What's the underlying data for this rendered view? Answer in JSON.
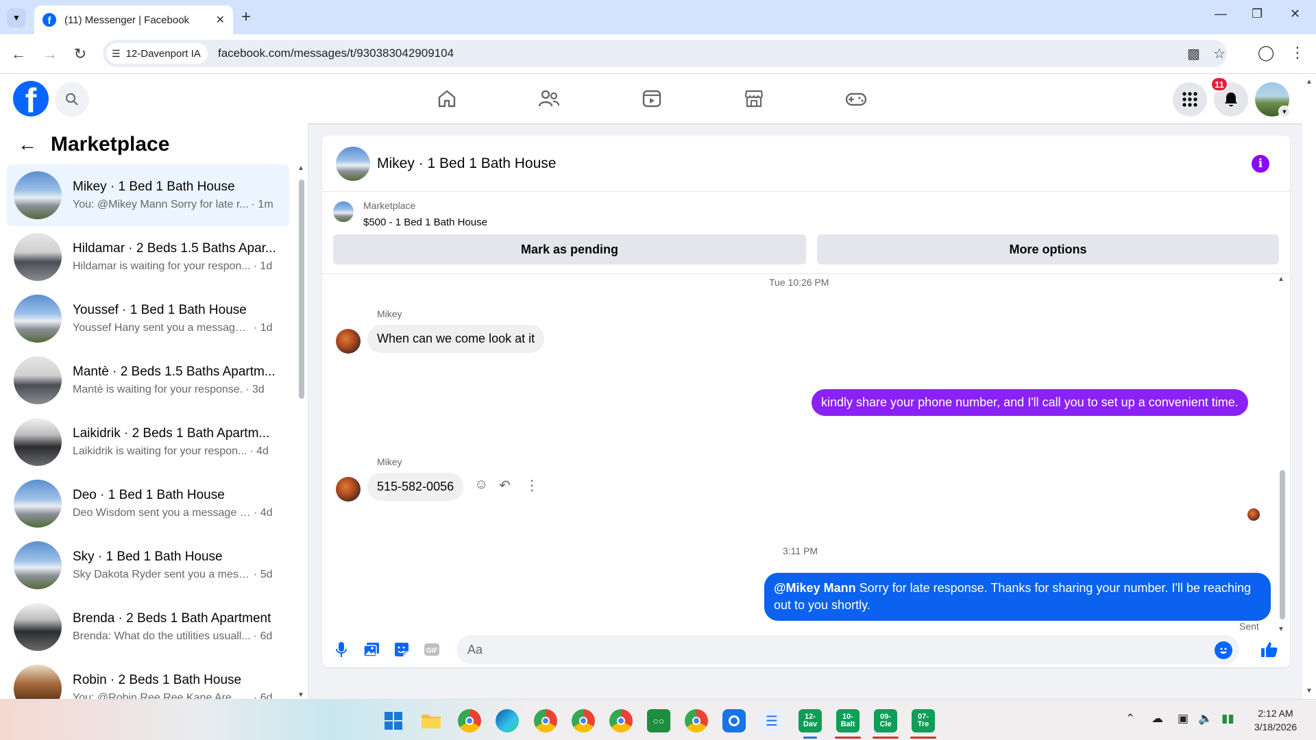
{
  "browser": {
    "tab_title": "(11) Messenger | Facebook",
    "site_chip": "12-Davenport IA",
    "url": "facebook.com/messages/t/930383042909104"
  },
  "header": {
    "notification_count": "11",
    "nav_icons": [
      "home-icon",
      "friends-icon",
      "video-icon",
      "marketplace-icon",
      "gaming-icon"
    ]
  },
  "sidebar": {
    "title": "Marketplace",
    "conversations": [
      {
        "name": "Mikey · 1 Bed 1 Bath House",
        "preview": "You: @Mikey Mann Sorry for late r...",
        "time": "· 1m",
        "thumb": "house"
      },
      {
        "name": "Hildamar · 2 Beds 1.5 Baths Apar...",
        "preview": "Hildamar is waiting for your respon...",
        "time": "· 1d",
        "thumb": "kitchen"
      },
      {
        "name": "Youssef · 1 Bed 1 Bath House",
        "preview": "Youssef Hany sent you a message a...",
        "time": "· 1d",
        "thumb": "house"
      },
      {
        "name": "Mantè · 2 Beds 1.5 Baths Apartm...",
        "preview": "Mantè is waiting for your response.",
        "time": "· 3d",
        "thumb": "kitchen"
      },
      {
        "name": "Laikidrik · 2 Beds 1 Bath Apartm...",
        "preview": "Laikidrik is waiting for your respon...",
        "time": "· 4d",
        "thumb": "dark"
      },
      {
        "name": "Deo · 1 Bed 1 Bath House",
        "preview": "Deo Wisdom sent you a message a...",
        "time": "· 4d",
        "thumb": "house"
      },
      {
        "name": "Sky · 1 Bed 1 Bath House",
        "preview": "Sky Dakota Ryder sent you a messa...",
        "time": "· 5d",
        "thumb": "house"
      },
      {
        "name": "Brenda · 2 Beds 1 Bath Apartment",
        "preview": "Brenda: What do the utilities usuall...",
        "time": "· 6d",
        "thumb": "dark"
      },
      {
        "name": "Robin · 2 Beds 1 Bath House",
        "preview": "You: @Robin Ree Ree Kane Are you...",
        "time": "· 6d",
        "thumb": "wood"
      }
    ]
  },
  "chat": {
    "title": "Mikey · 1 Bed 1 Bath House",
    "marketplace_label": "Marketplace",
    "listing": "$500 - 1 Bed 1 Bath House",
    "mark_pending_label": "Mark as pending",
    "more_options_label": "More options",
    "timestamp1": "Tue 10:26 PM",
    "sender1": "Mikey",
    "msg1": "When can we come look at it",
    "msg2": "kindly share your phone number, and I'll call you to set up a convenient time.",
    "sender2": "Mikey",
    "msg3": "515-582-0056",
    "timestamp2": "3:11 PM",
    "msg4_mention": "@Mikey Mann",
    "msg4_text": " Sorry for late response. Thanks for sharing your number. I'll be reaching out to you shortly.",
    "sent_label": "Sent",
    "composer_placeholder": "Aa"
  },
  "taskbar": {
    "tiles": [
      "12-Dav",
      "10-Balt",
      "09-Cle",
      "07-Tre"
    ],
    "clock_time": "2:12 AM",
    "clock_date": "3/18/2026"
  },
  "colors": {
    "fb_blue": "#0866ff",
    "outgoing_purple": "#8a21f6",
    "outgoing_blue": "#0a62ee",
    "info_purple": "#8a0bf4"
  }
}
